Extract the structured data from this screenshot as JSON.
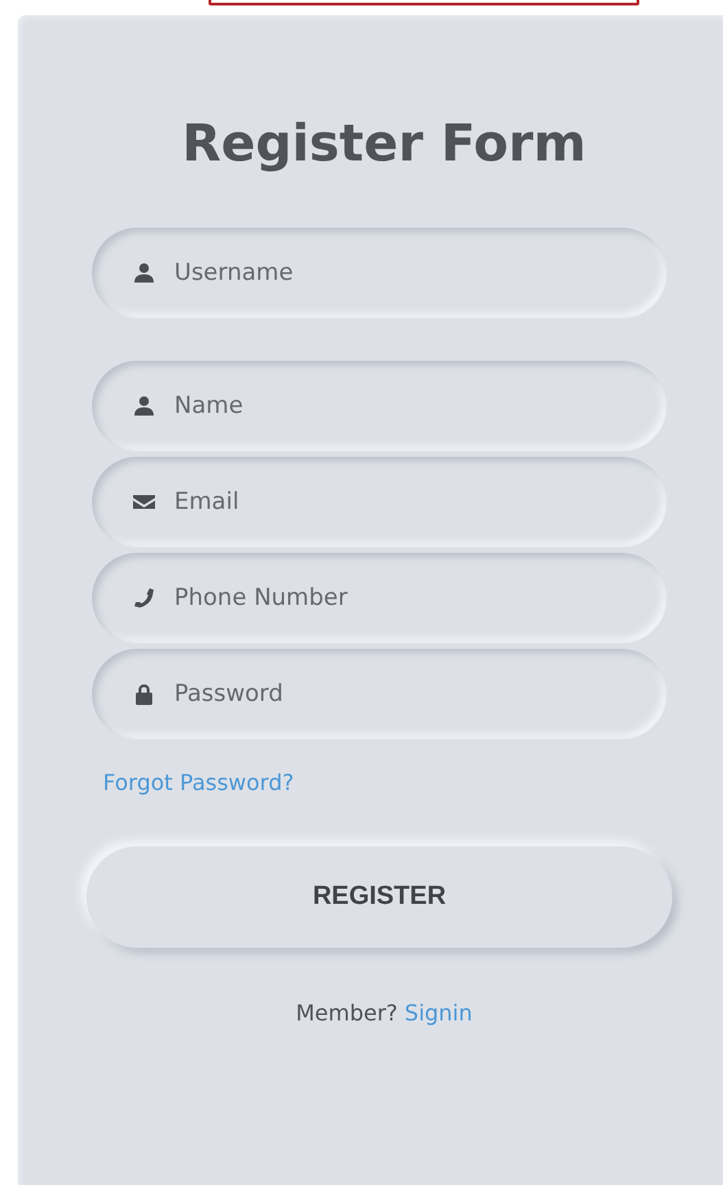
{
  "title": "Register Form",
  "fields": [
    {
      "kind": "user",
      "placeholder": "Username"
    },
    {
      "kind": "user",
      "placeholder": "Name"
    },
    {
      "kind": "email",
      "placeholder": "Email"
    },
    {
      "kind": "phone",
      "placeholder": "Phone Number"
    },
    {
      "kind": "password",
      "placeholder": "Password"
    }
  ],
  "forgot_link": "Forgot Password?",
  "register_button": "REGISTER",
  "footer": {
    "text": "Member?",
    "link": "Signin"
  }
}
